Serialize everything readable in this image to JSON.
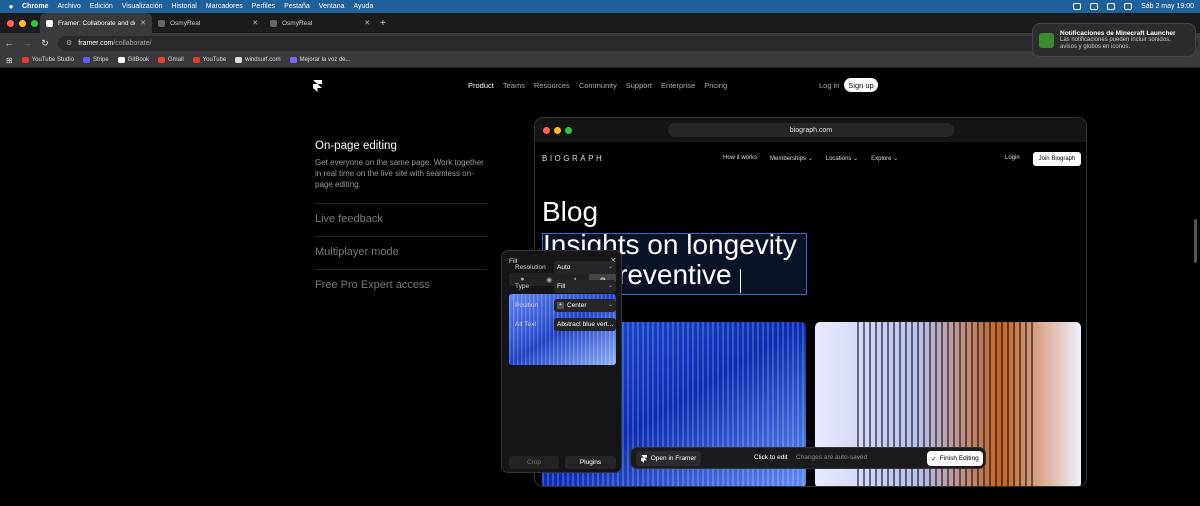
{
  "menubar": {
    "items": [
      "Chrome",
      "Archivo",
      "Edición",
      "Visualización",
      "Historial",
      "Marcadores",
      "Perfiles",
      "Pestaña",
      "Ventana",
      "Ayuda"
    ],
    "datetime": "Sáb 2 may 19:00"
  },
  "tabs": [
    {
      "title": "Framer: Collaborate and desi",
      "active": true
    },
    {
      "title": "OsmyReal",
      "active": false
    },
    {
      "title": "OsmyReal",
      "active": false
    }
  ],
  "address": {
    "domain": "framer.com",
    "path": "/collaborate/"
  },
  "bookmarks": [
    {
      "label": "YouTube Studio",
      "color": "#e53935"
    },
    {
      "label": "Stripe",
      "color": "#635bff"
    },
    {
      "label": "GitBook",
      "color": "#ffffff"
    },
    {
      "label": "Gmail",
      "color": "#ea4335"
    },
    {
      "label": "YouTube",
      "color": "#e53935"
    },
    {
      "label": "windsurf.com",
      "color": "#dddddd"
    },
    {
      "label": "Mejorar la voz de...",
      "color": "#7b68ee"
    }
  ],
  "notification": {
    "title": "Notificaciones de Minecraft Launcher",
    "body": "Las notificaciones pueden incluir sonidos, avisos y globos en iconos."
  },
  "site_nav": {
    "links": [
      "Product",
      "Teams",
      "Resources",
      "Community",
      "Support",
      "Enterprise",
      "Pricing"
    ],
    "active": "Product",
    "login": "Log in",
    "signup": "Sign up"
  },
  "features": {
    "active_title": "On-page editing",
    "active_desc": "Get everyone on the same page. Work together in real time on the live site with seamless on-page editing.",
    "others": [
      "Live feedback",
      "Multiplayer mode",
      "Free Pro Expert access"
    ]
  },
  "demo": {
    "url": "biograph.com",
    "logo": "BIOGRAPH",
    "nav": [
      "How it works",
      "Memberships ⌄",
      "Locations ⌄",
      "Explore ⌄"
    ],
    "login": "Login",
    "join": "Join Biograph",
    "blog_title": "Blog",
    "heading_line1": "Insights on longevity",
    "heading_line2": "reventive"
  },
  "editbar": {
    "open": "Open in Framer",
    "click_to_edit": "Click to edit",
    "autosaved": "Changes are auto-saved",
    "finish": "Finish Editing"
  },
  "fill_panel": {
    "title": "Fill",
    "rows": [
      {
        "label": "Resolution",
        "value": "Auto"
      },
      {
        "label": "Type",
        "value": "Fill"
      },
      {
        "label": "Position",
        "value": "Center"
      },
      {
        "label": "Alt Text",
        "value": "Abstract blue vert..."
      }
    ],
    "crop": "Crop",
    "plugins": "Plugins"
  },
  "colors": {
    "menubar": "#1f5f9a",
    "accent_blue": "#3a67c9",
    "light_red": "#ff5f57",
    "light_yellow": "#febc2e",
    "light_green": "#28c840"
  }
}
